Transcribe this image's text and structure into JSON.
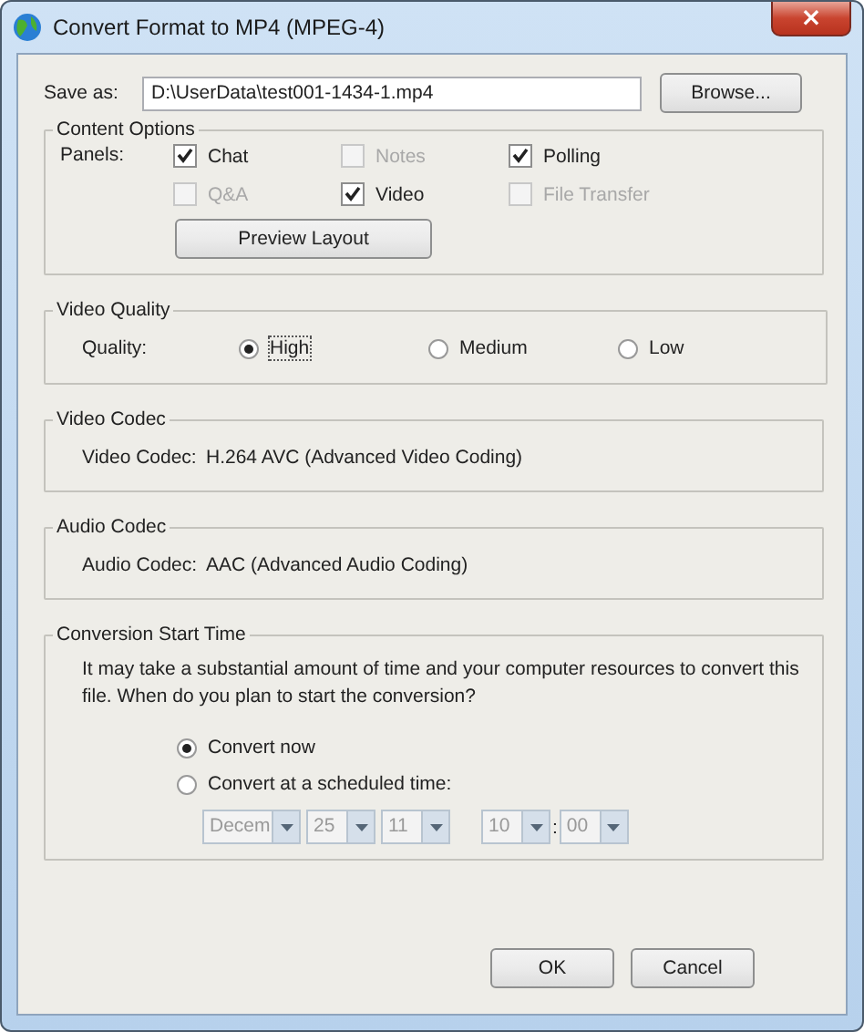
{
  "window": {
    "title": "Convert Format to MP4 (MPEG-4)",
    "close": "×"
  },
  "save_as": {
    "label": "Save as:",
    "value": "D:\\UserData\\test001-1434-1.mp4",
    "button": "Browse..."
  },
  "content_options": {
    "title": "Content Options",
    "label": "Panels:",
    "panels": [
      {
        "label": "Chat",
        "checked": true,
        "disabled": false
      },
      {
        "label": "Notes",
        "checked": false,
        "disabled": true
      },
      {
        "label": "Polling",
        "checked": true,
        "disabled": false
      },
      {
        "label": "Q&A",
        "checked": false,
        "disabled": true
      },
      {
        "label": "Video",
        "checked": true,
        "disabled": false
      },
      {
        "label": "File Transfer",
        "checked": false,
        "disabled": true
      }
    ],
    "button": "Preview Layout"
  },
  "video_quality": {
    "title": "Video Quality",
    "label": "Quality:",
    "options": [
      {
        "label": "High",
        "selected": true,
        "focused": true
      },
      {
        "label": "Medium",
        "selected": false,
        "focused": false
      },
      {
        "label": "Low",
        "selected": false,
        "focused": false
      }
    ]
  },
  "video_codec": {
    "title": "Video Codec",
    "label": "Video Codec:",
    "value": "H.264 AVC (Advanced Video Coding)"
  },
  "audio_codec": {
    "title": "Audio Codec",
    "label": "Audio Codec:",
    "value": "AAC (Advanced Audio Coding)"
  },
  "conversion": {
    "title": "Conversion Start Time",
    "message": "It may take a substantial amount of time and your computer resources to convert this file. When do you plan to start the conversion?",
    "options": [
      {
        "label": "Convert now",
        "selected": true
      },
      {
        "label": "Convert at a scheduled time:",
        "selected": false
      }
    ],
    "date": [
      {
        "value": "Decem",
        "disabled": true
      },
      {
        "value": "25",
        "disabled": true
      },
      {
        "value": "11",
        "disabled": true
      }
    ],
    "time": {
      "hour": {
        "value": "10",
        "disabled": true
      },
      "separator": ":",
      "minute": {
        "value": "00",
        "disabled": true
      }
    }
  },
  "buttons": [
    "OK",
    "Cancel"
  ]
}
